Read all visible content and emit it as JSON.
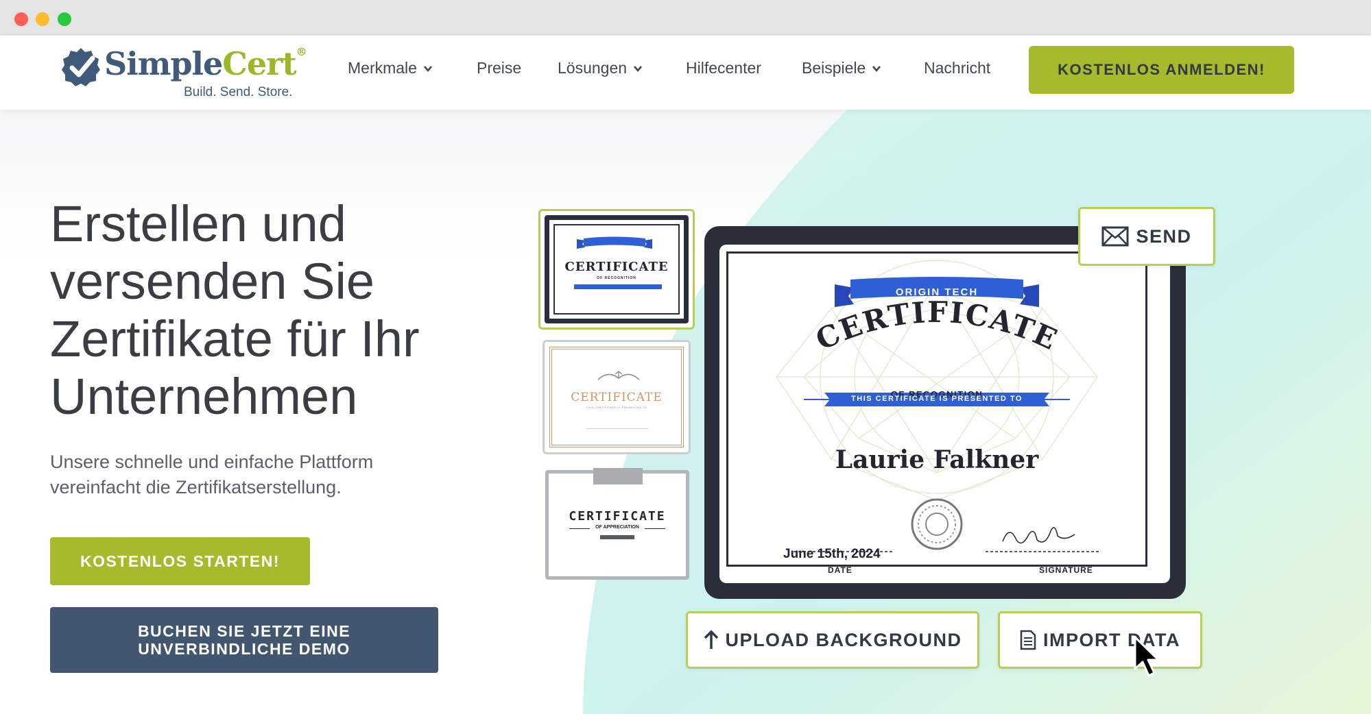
{
  "window": {
    "controls": [
      "close",
      "minimize",
      "maximize"
    ]
  },
  "nav": {
    "logo": {
      "word_a": "Simple",
      "word_b": "Cert",
      "registered": "®",
      "tagline": "Build. Send. Store."
    },
    "items": [
      {
        "label": "Merkmale",
        "dropdown": true
      },
      {
        "label": "Preise",
        "dropdown": false
      },
      {
        "label": "Lösungen",
        "dropdown": true
      },
      {
        "label": "Hilfecenter",
        "dropdown": false
      },
      {
        "label": "Beispiele",
        "dropdown": true
      },
      {
        "label": "Nachricht",
        "dropdown": false
      }
    ],
    "cta": "KOSTENLOS ANMELDEN!"
  },
  "hero": {
    "headline": "Erstellen und versenden Sie Zertifikate für Ihr Unternehmen",
    "subhead": "Unsere schnelle und einfache Plattform vereinfacht die Zertifikatserstellung.",
    "start_button": "KOSTENLOS STARTEN!",
    "demo_button_line1": "BUCHEN SIE JETZT EINE",
    "demo_button_line2": "UNVERBINDLICHE DEMO"
  },
  "thumbnails": [
    {
      "title": "CERTIFICATE",
      "subtitle": "OF RECOGNITION"
    },
    {
      "title": "CERTIFICATE",
      "subtitle": "THIS CERTIFICATE IS PRESENTED TO"
    },
    {
      "title": "CERTIFICATE",
      "subtitle": "OF APPRECIATION"
    }
  ],
  "certificate": {
    "org": "ORIGIN TECH",
    "title": "CERTIFICATE",
    "subtitle": "OF RECOGNITION",
    "presented": "THIS CERTIFICATE IS PRESENTED TO",
    "recipient": "Laurie Falkner",
    "date": "June 15th, 2024",
    "date_label": "DATE",
    "signature_label": "SIGNATURE"
  },
  "actions": {
    "send": "SEND",
    "upload": "UPLOAD BACKGROUND",
    "import": "IMPORT DATA"
  },
  "colors": {
    "accent": "#a6ba2c",
    "navy": "#42576f",
    "cert_blue": "#2f5fd6",
    "dark": "#2b2d38"
  }
}
